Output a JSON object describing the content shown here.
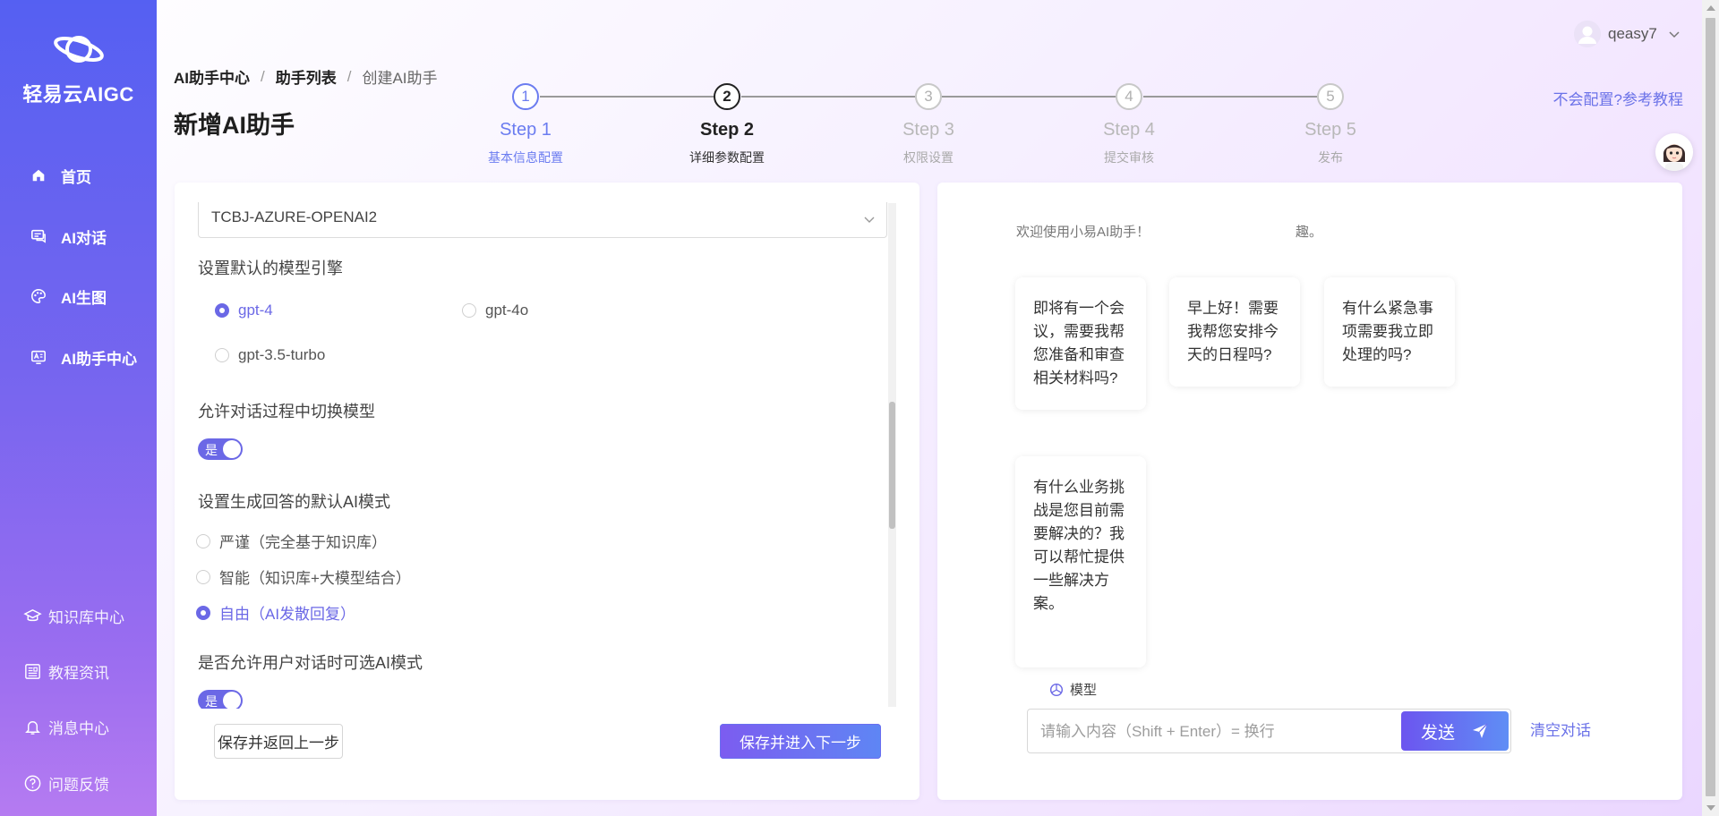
{
  "sidebar": {
    "brand": "轻易云AIGC",
    "items": [
      {
        "label": "首页",
        "icon": "home-icon"
      },
      {
        "label": "AI对话",
        "icon": "chat-icon"
      },
      {
        "label": "AI生图",
        "icon": "palette-icon"
      },
      {
        "label": "AI助手中心",
        "icon": "assistant-icon"
      }
    ],
    "bottom_items": [
      {
        "label": "知识库中心",
        "icon": "graduation-cap-icon"
      },
      {
        "label": "教程资讯",
        "icon": "news-icon"
      },
      {
        "label": "消息中心",
        "icon": "bell-icon"
      },
      {
        "label": "问题反馈",
        "icon": "help-icon"
      }
    ]
  },
  "breadcrumb": [
    "AI助手中心",
    "助手列表",
    "创建AI助手"
  ],
  "page_title": "新增AI助手",
  "steps": [
    {
      "number": "1",
      "title": "Step 1",
      "desc": "基本信息配置",
      "state": "done"
    },
    {
      "number": "2",
      "title": "Step 2",
      "desc": "详细参数配置",
      "state": "active"
    },
    {
      "number": "3",
      "title": "Step 3",
      "desc": "权限设置",
      "state": "pending"
    },
    {
      "number": "4",
      "title": "Step 4",
      "desc": "提交审核",
      "state": "pending"
    },
    {
      "number": "5",
      "title": "Step 5",
      "desc": "发布",
      "state": "pending"
    }
  ],
  "tutorial_link": "不会配置?参考教程",
  "user": {
    "name": "qeasy7"
  },
  "form": {
    "engine_select": "TCBJ-AZURE-OPENAI2",
    "model_label": "设置默认的模型引擎",
    "models": [
      {
        "label": "gpt-4",
        "selected": true
      },
      {
        "label": "gpt-4o",
        "selected": false
      },
      {
        "label": "gpt-3.5-turbo",
        "selected": false
      }
    ],
    "switch_model_label": "允许对话过程中切换模型",
    "switch_model_value": "是",
    "mode_label": "设置生成回答的默认AI模式",
    "modes": [
      {
        "label": "严谨（完全基于知识库）",
        "selected": false
      },
      {
        "label": "智能（知识库+大模型结合）",
        "selected": false
      },
      {
        "label": "自由（AI发散回复）",
        "selected": true
      }
    ],
    "user_mode_label": "是否允许用户对话时可选AI模式",
    "user_mode_value": "是",
    "back_button": "保存并返回上一步",
    "next_button": "保存并进入下一步"
  },
  "chat": {
    "welcome": "欢迎使用小易AI助手！",
    "welcome_tail": "趣。",
    "suggestions": [
      "即将有一个会议，需要我帮您准备和审查相关材料吗?",
      "早上好！需要我帮您安排今天的日程吗?",
      "有什么紧急事项需要我立即处理的吗?",
      "有什么业务挑战是您目前需要解决的？我可以帮忙提供一些解决方案。"
    ],
    "model_tag": "模型",
    "input_placeholder": "请输入内容（Shift + Enter）= 换行",
    "send_button": "发送",
    "clear_link": "清空对话"
  },
  "colors": {
    "accent": "#6b68e6",
    "link": "#6b72e8",
    "sidebar_top": "#5560f2",
    "sidebar_bottom": "#b57bf1"
  }
}
